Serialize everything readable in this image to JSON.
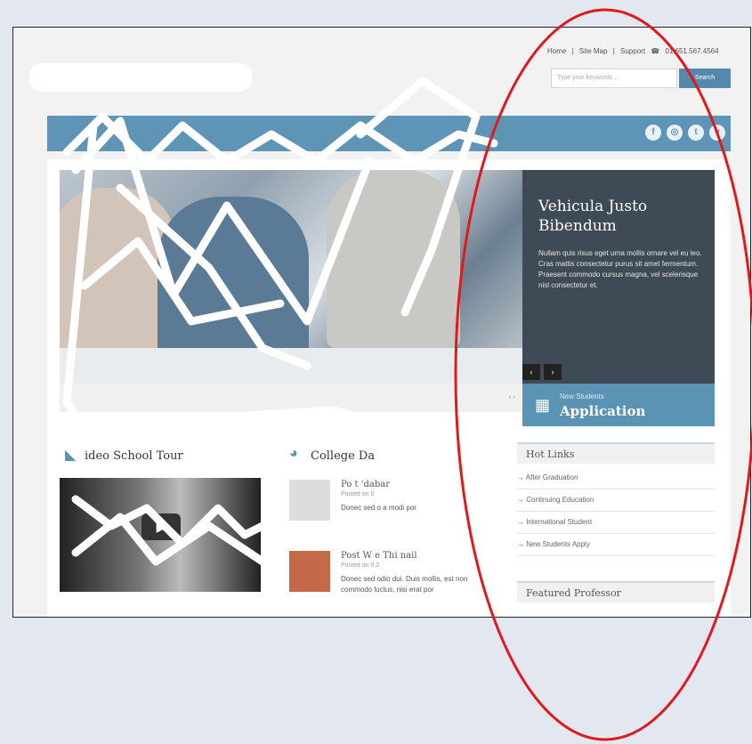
{
  "utility": {
    "home": "Home",
    "sep1": "|",
    "sitemap": "Site Map",
    "sep2": "|",
    "support": "Support",
    "phone": "01.651.567.4564"
  },
  "search": {
    "placeholder": "Type your keywords...",
    "button": "Search"
  },
  "social": [
    {
      "icon": "facebook-icon",
      "glyph": "f"
    },
    {
      "icon": "instagram-icon",
      "glyph": "◎"
    },
    {
      "icon": "twitter-icon",
      "glyph": "t"
    },
    {
      "icon": "vimeo-icon",
      "glyph": "v"
    }
  ],
  "feature": {
    "title": "Vehicula Justo Bibendum",
    "body": "Nullam quis risus eget urna mollis ornare vel eu leo. Cras mattis consectetur purus sit amet fermentum. Praesent commodo cursus magna, vel scelerisque nisl consectetur et.",
    "prev": "‹",
    "next": "›"
  },
  "apply": {
    "subtitle": "New Students",
    "title": "Application"
  },
  "hero": {
    "pager": "‹ ›"
  },
  "video_section": {
    "title": "ideo School Tour"
  },
  "news_section": {
    "title": "College Da"
  },
  "news": [
    {
      "title": "Po     t  'dabar",
      "meta": "Posted on 0",
      "body": "Donec sed o       a modi        por"
    },
    {
      "title": "Post W      e Thi      nail",
      "meta": "Posted on 0  2",
      "body": "Donec sed odio dui. Duis mollis, est non commodo luctus, nisi erat por"
    }
  ],
  "hot_links": {
    "title": "Hot Links",
    "items": [
      "After Graduation",
      "Continuing Education",
      "International Student",
      "New Students Apply"
    ]
  },
  "featured": {
    "title": "Featured Professor"
  },
  "colors": {
    "nav": "#5e95b6",
    "accent": "#5b93b4",
    "annotation": "#e0191c"
  }
}
